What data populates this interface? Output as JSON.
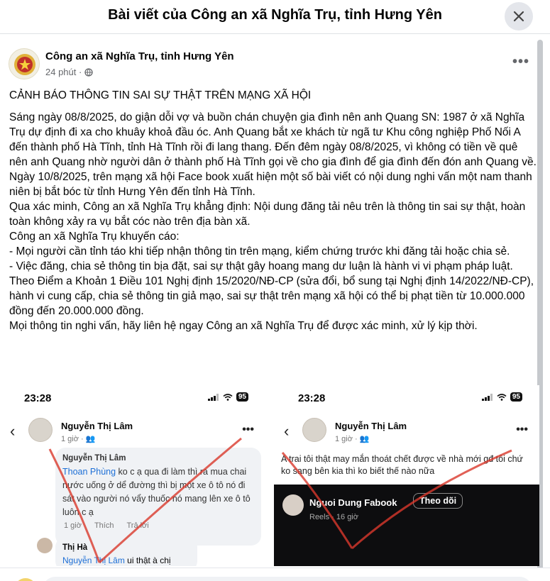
{
  "dialog": {
    "title": "Bài viết của Công an xã Nghĩa Trụ, tỉnh Hưng Yên",
    "close_icon": "close-icon"
  },
  "post": {
    "author": "Công an xã Nghĩa Trụ, tỉnh Hưng Yên",
    "time": "24 phút ·",
    "privacy_icon": "globe-icon",
    "more_label": "•••",
    "heading": "CẢNH BÁO THÔNG TIN SAI SỰ THẬT TRÊN MẠNG XÃ HỘI",
    "paragraphs": [
      "Sáng ngày 08/8/2025, do giận dỗi vợ và buồn chán chuyện gia đình nên anh Quang SN: 1987 ở xã Nghĩa Trụ dự định đi xa cho khuây khoả đầu óc. Anh Quang bắt xe khách từ ngã tư Khu công nghiệp Phố Nối A đến thành phố Hà Tĩnh, tỉnh Hà Tĩnh rồi đi lang thang. Đến đêm ngày 08/8/2025, vì không có tiền về quê nên anh Quang nhờ người dân ở thành phố Hà Tĩnh gọi về cho gia đình để gia đình đến đón anh Quang về. Ngày 10/8/2025, trên mạng xã hội Face book xuất hiện một số bài viết có nội dung nghi vấn một nam thanh niên bị bắt bóc từ tỉnh Hưng Yên đến tỉnh Hà Tĩnh.",
      "Qua xác minh, Công an xã Nghĩa Trụ khẳng định: Nội dung đăng tải nêu trên là thông tin sai sự thật, hoàn toàn không xảy ra vụ bắt cóc nào trên địa bàn xã.",
      "Công an xã Nghĩa Trụ khuyến cáo:",
      " - Mọi người cần tỉnh táo khi tiếp nhận thông tin trên mạng, kiểm chứng trước khi đăng tải hoặc chia sẻ.",
      " - Việc đăng, chia sẻ thông tin bịa đặt, sai sự thật gây hoang mang dư luận là hành vi vi phạm pháp luật.",
      "Theo Điểm a Khoản 1 Điều 101 Nghị định 15/2020/NĐ-CP (sửa đổi, bổ sung tại Nghị định 14/2022/NĐ-CP), hành vi cung cấp, chia sẻ thông tin giả mạo, sai sự thật trên mạng xã hội có thể bị phạt tiền từ 10.000.000 đồng đến 20.000.000 đồng.",
      "Mọi thông tin nghi vấn, hãy liên hệ ngay Công an xã Nghĩa Trụ để được xác minh, xử lý kịp thời."
    ]
  },
  "screenshot_left": {
    "time": "23:28",
    "battery": "95",
    "name": "Nguyễn Thị Lâm",
    "sub": "1 giờ · ",
    "comment_author": "Nguyễn Thị Lâm",
    "comment_mention": "Thoan Phùng",
    "comment_text": " ko c ạ qua đi làm thì ra mua chai nước uống ở dể đường thì bị một xe ô tô nó đi sát vào người nó vẩy thuốc nó mang lên xe ô tô luôn c ạ",
    "actions": [
      "1 giờ",
      "Thích",
      "Trả lời"
    ],
    "reply_author": "Thị Hà",
    "reply_mention": "Nguyễn Thị Lâm",
    "reply_text": " ui thật à chị"
  },
  "screenshot_right": {
    "time": "23:28",
    "battery": "95",
    "name": "Nguyễn Thị Lâm",
    "sub": "1 giờ · ",
    "text": "A trai tôi thật may mắn thoát chết được về nhà mới gđ  tôi chứ ko sang bên kia thì ko biết thế nào nữa",
    "reel_name": "Nguoi Dung Fabook",
    "follow_label": "Theo dõi",
    "reel_meta": "Reels · 16 giờ"
  }
}
